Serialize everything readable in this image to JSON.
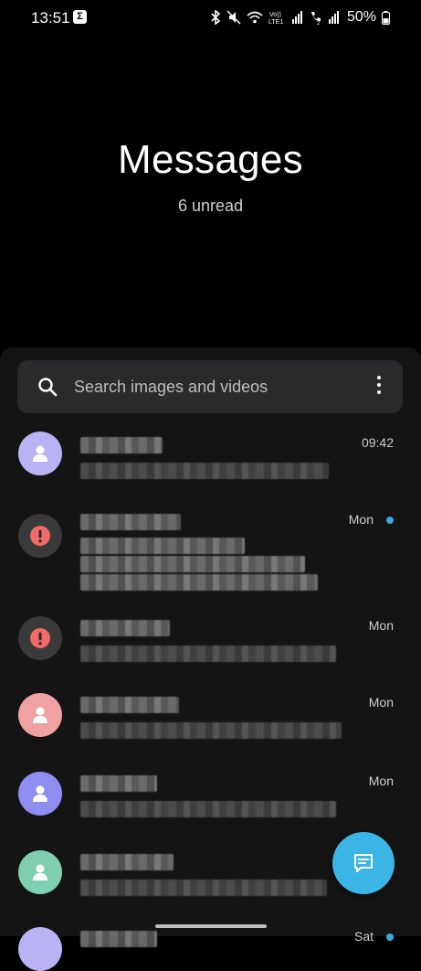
{
  "status_bar": {
    "time": "13:51",
    "notification_icon": "sigma-app-icon",
    "battery": "50%",
    "icons": [
      "bluetooth-icon",
      "mute-icon",
      "wifi-icon",
      "volte-icon",
      "signal-icon",
      "call-signal-icon",
      "signal-icon",
      "battery-icon"
    ]
  },
  "header": {
    "title": "Messages",
    "subtitle": "6 unread"
  },
  "search": {
    "placeholder": "Search images and videos"
  },
  "conversations": [
    {
      "time": "09:42",
      "unread": false,
      "avatar_color": "#b9b3f5",
      "avatar_icon": "person-icon"
    },
    {
      "time": "Mon",
      "unread": true,
      "avatar_color": "#3a3a3a",
      "avatar_icon": "warning-icon"
    },
    {
      "time": "Mon",
      "unread": false,
      "avatar_color": "#3a3a3a",
      "avatar_icon": "warning-icon"
    },
    {
      "time": "Mon",
      "unread": false,
      "avatar_color": "#f0a1a1",
      "avatar_icon": "person-icon"
    },
    {
      "time": "Mon",
      "unread": false,
      "avatar_color": "#8f8df0",
      "avatar_icon": "person-icon"
    },
    {
      "time": "",
      "unread": false,
      "avatar_color": "#7fcfb0",
      "avatar_icon": "person-icon"
    },
    {
      "time": "Sat",
      "unread": true,
      "avatar_color": "#b9b3f5",
      "avatar_icon": "person-icon"
    }
  ],
  "colors": {
    "accent": "#3bb5e6",
    "unread_dot": "#3aa8e0",
    "panel": "#141414",
    "search_bg": "#2a2a2c"
  },
  "fab": {
    "icon": "compose-message-icon"
  }
}
